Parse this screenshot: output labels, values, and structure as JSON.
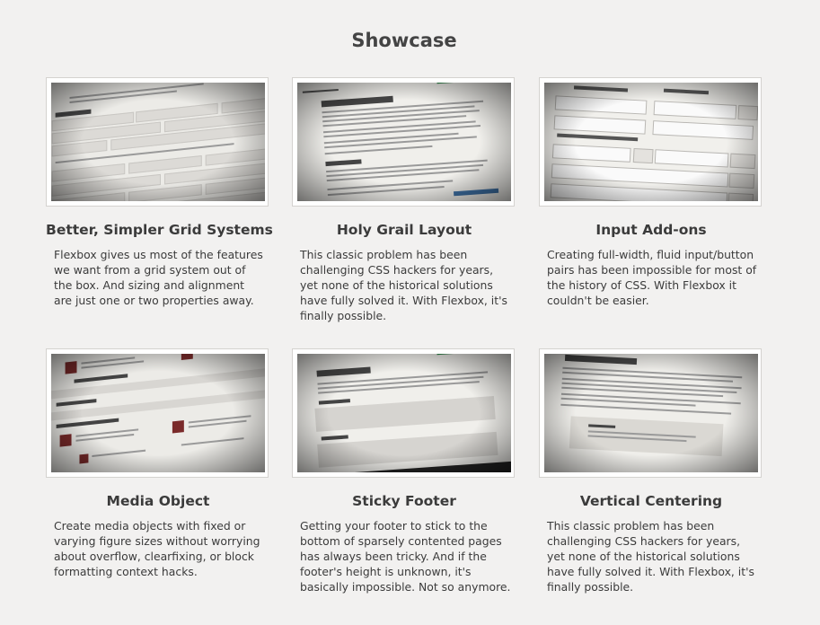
{
  "page": {
    "title": "Showcase"
  },
  "cards": [
    {
      "title": "Better, Simpler Grid Systems",
      "desc": "Flexbox gives us most of the features we want from a grid system out of the box. And sizing and alignment are just one or two properties away."
    },
    {
      "title": "Holy Grail Layout",
      "desc": "This classic problem has been challenging CSS hackers for years, yet none of the historical solutions have fully solved it. With Flexbox, it's finally possible."
    },
    {
      "title": "Input Add-ons",
      "desc": "Creating full-width, fluid input/button pairs has been impossible for most of the history of CSS. With Flexbox it couldn't be easier."
    },
    {
      "title": "Media Object",
      "desc": "Create media objects with fixed or varying figure sizes without worrying about overflow, clearfixing, or block formatting context hacks."
    },
    {
      "title": "Sticky Footer",
      "desc": "Getting your footer to stick to the bottom of sparsely contented pages has always been tricky. And if the footer's height is unknown, it's basically impossible. Not so anymore."
    },
    {
      "title": "Vertical Centering",
      "desc": "This classic problem has been challenging CSS hackers for years, yet none of the historical solutions have fully solved it. With Flexbox, it's finally possible."
    }
  ],
  "thumbs": {
    "grid": {
      "heading": "Grid · Examples",
      "cells": [
        "Full",
        "Full",
        "Full / Content",
        "Full / Content",
        "Full / Content",
        "1/2",
        "1/3",
        "1/2",
        "1/3",
        "1/2"
      ]
    },
    "holy": {
      "heading": "Holy Grail Layout",
      "sub": "The HTML"
    },
    "addons": {
      "label_left": "Add-on Prepended",
      "label_right": "Add-on Appended",
      "label_both": "Appended and Prepended Add-ons",
      "field_1": "Text",
      "field_2": "Example Text",
      "field_3": "Stronger",
      "field_4": "Go",
      "field_5": "Backup"
    },
    "media": {
      "h1": "Nested Media Object",
      "h2": "Mini-Images",
      "h3": "Nested Media Objects",
      "h4": "Media Object Title",
      "h5": "Media Object Title"
    },
    "sticky": {
      "heading": "Sticky Footer",
      "sub1": "The HTML",
      "sub2": "The CSS"
    },
    "vcenter": {
      "heading": "Vertical Centering",
      "box": "I'm Centered"
    }
  }
}
